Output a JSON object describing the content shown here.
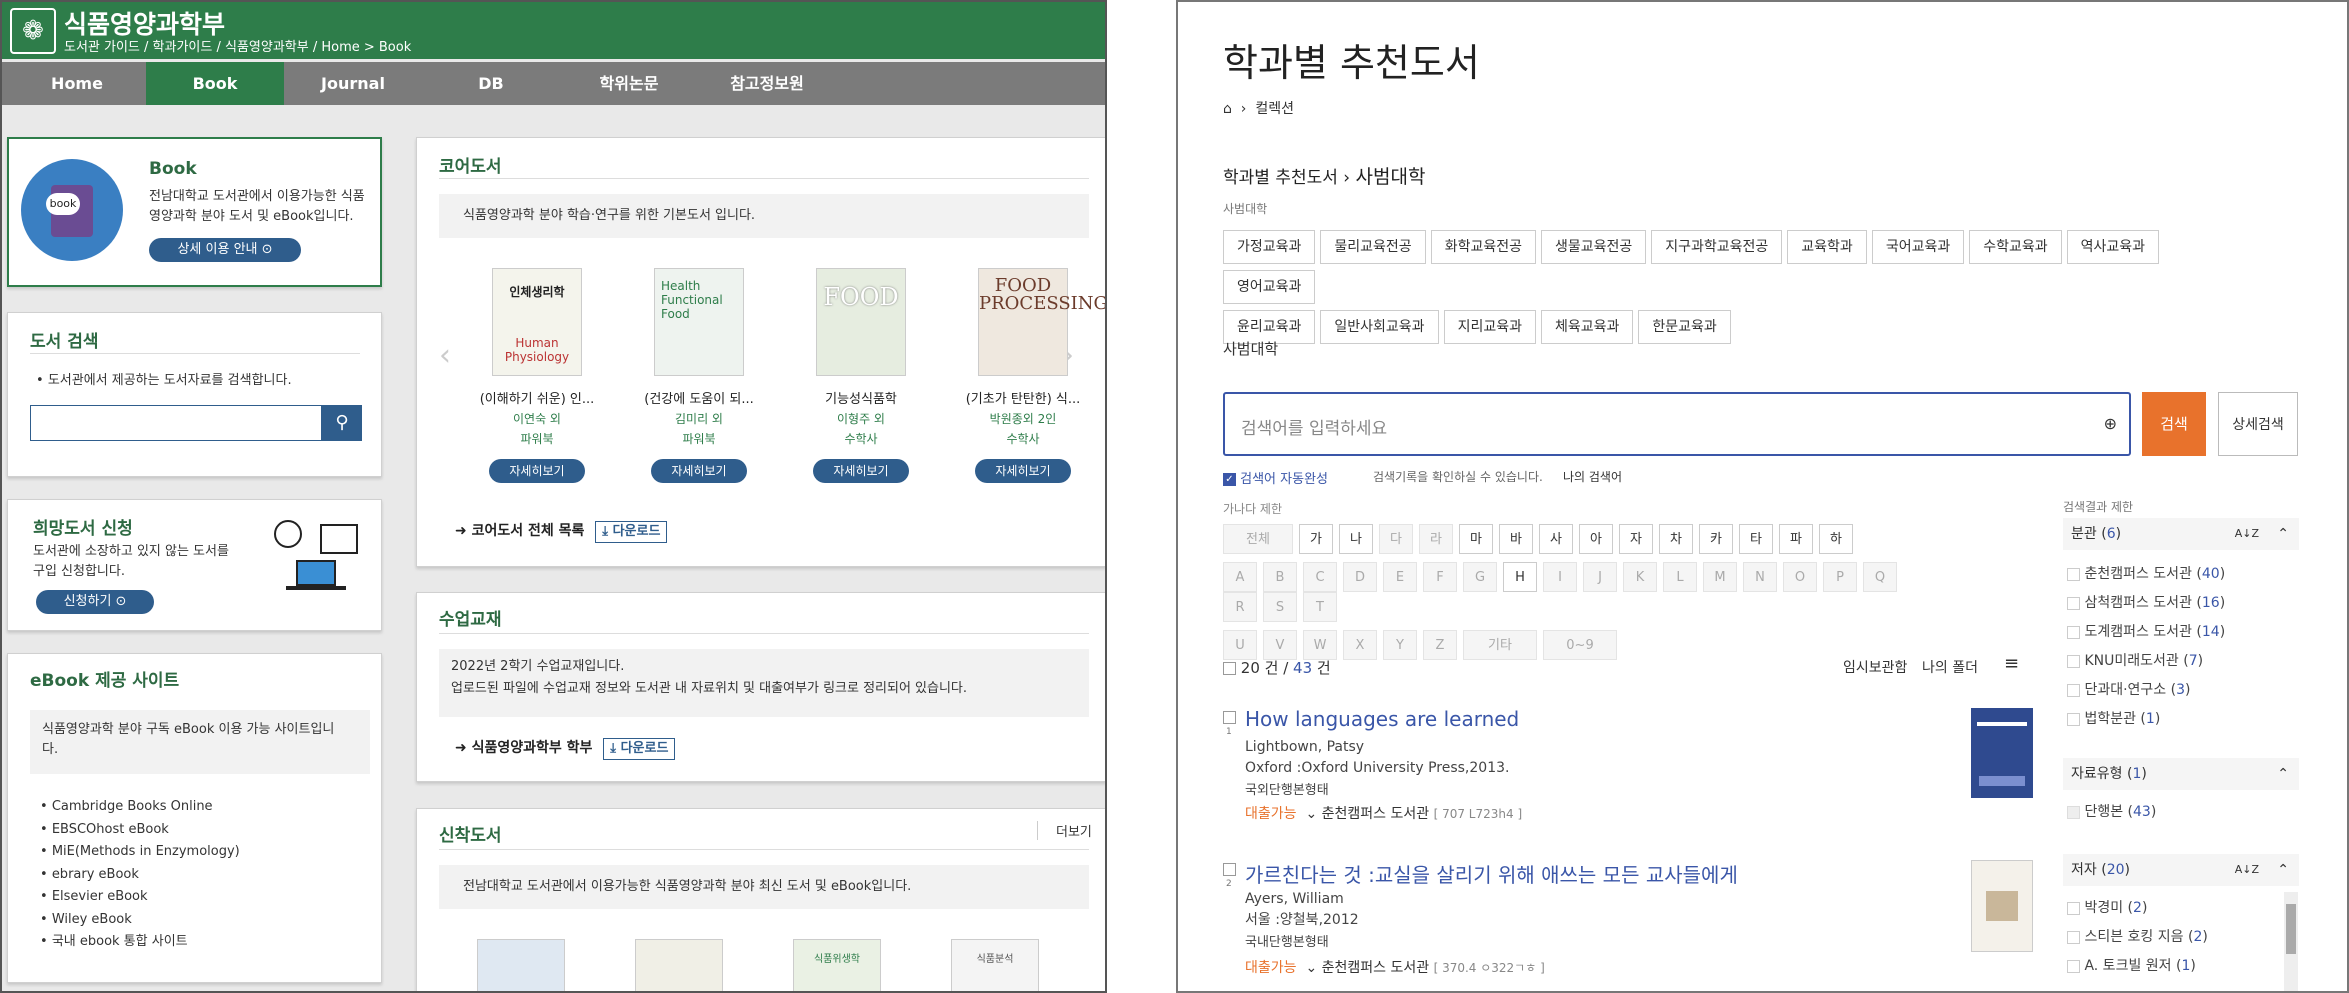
{
  "left": {
    "title": "식품영양과학부",
    "breadcrumb": "도서관 가이드 / 학과가이드 / 식품영양과학부 / Home > Book",
    "nav": [
      "Home",
      "Book",
      "Journal",
      "DB",
      "학위논문",
      "참고정보원"
    ],
    "book_box": {
      "icon_label": "book",
      "title": "Book",
      "desc1": "전남대학교 도서관에서 이용가능한 식품",
      "desc2": "영양과학 분야 도서 및 eBook입니다.",
      "button": "상세 이용 안내"
    },
    "search": {
      "title": "도서 검색",
      "desc": "도서관에서 제공하는 도서자료를 검색합니다."
    },
    "request": {
      "title": "희망도서 신청",
      "desc1": "도서관에 소장하고 있지 않는 도서를",
      "desc2": "구입 신청합니다.",
      "button": "신청하기"
    },
    "ebook": {
      "title": "eBook 제공 사이트",
      "desc": "식품영양과학 분야 구독 eBook 이용 가능 사이트입니",
      "desc2": "다.",
      "sites": [
        "Cambridge Books Online",
        "EBSCOhost eBook",
        "MiE(Methods in Enzymology)",
        "ebrary eBook",
        "Elsevier eBook",
        "Wiley eBook",
        "국내 ebook 통합 사이트"
      ]
    },
    "core": {
      "title": "코어도서",
      "desc": "식품영양과학 분야 학습·연구를 위한 기본도서 입니다.",
      "more": "코어도서 전체 목록",
      "download": "다운로드",
      "books": [
        {
          "title": "(이해하기 쉬운) 인...",
          "author": "이연숙 외",
          "publisher": "파워북",
          "button": "자세히보기",
          "cover_text": "인체생리학",
          "cover_sub": "Human Physiology"
        },
        {
          "title": "(건강에 도움이 되...",
          "author": "김미리 외",
          "publisher": "파워북",
          "button": "자세히보기",
          "cover_text": "Health Functional Food",
          "cover_sub": ""
        },
        {
          "title": "기능성식품학",
          "author": "이형주 외",
          "publisher": "수학사",
          "button": "자세히보기",
          "cover_text": "FOOD",
          "cover_sub": ""
        },
        {
          "title": "(기초가 탄탄한) 식...",
          "author": "박원종외 2인",
          "publisher": "수학사",
          "button": "자세히보기",
          "cover_text": "FOOD PROCESSING",
          "cover_sub": ""
        }
      ]
    },
    "textbook": {
      "title": "수업교재",
      "line1": "2022년 2학기 수업교재입니다.",
      "line2": "업로드된 파일에 수업교재 정보와 도서관 내 자료위치 및 대출여부가 링크로 정리되어 있습니다.",
      "item": "식품영양과학부 학부",
      "download": "다운로드"
    },
    "newbooks": {
      "title": "신착도서",
      "more": "더보기",
      "desc": "전남대학교 도서관에서 이용가능한 식품영양과학 분야 최신 도서 및 eBook입니다.",
      "cover_labels": [
        "",
        "",
        "식품위생학",
        "식품분석"
      ]
    }
  },
  "right": {
    "title": "학과별 추천도서",
    "crumb": "컬렉션",
    "section": "학과별 추천도서",
    "college": "사범대학",
    "college_small": "사범대학",
    "chips": [
      "가정교육과",
      "물리교육전공",
      "화학교육전공",
      "생물교육전공",
      "지구과학교육전공",
      "교육학과",
      "국어교육과",
      "수학교육과",
      "역사교육과",
      "영어교육과",
      "윤리교육과",
      "일반사회교육과",
      "지리교육과",
      "체육교육과",
      "한문교육과"
    ],
    "college_label": "사범대학",
    "search_placeholder": "검색어를 입력하세요",
    "search_btn": "검색",
    "adv_btn": "상세검색",
    "autocomplete": "검색어 자동완성",
    "history_note": "검색기록을 확인하실 수 있습니다.",
    "my_search": "나의 검색어",
    "alpha_label": "가나다 제한",
    "row1": [
      "전체",
      "가",
      "나",
      "다",
      "라",
      "마",
      "바",
      "사",
      "아",
      "자",
      "차",
      "카",
      "타",
      "파",
      "하"
    ],
    "row2": [
      "A",
      "B",
      "C",
      "D",
      "E",
      "F",
      "G",
      "H",
      "I",
      "J",
      "K",
      "L",
      "M",
      "N",
      "O",
      "P",
      "Q",
      "R",
      "S",
      "T"
    ],
    "row3": [
      "U",
      "V",
      "W",
      "X",
      "Y",
      "Z",
      "기타",
      "0~9"
    ],
    "count_shown": "20 건",
    "count_total": "43",
    "count_unit": "건",
    "temp_save": "임시보관함",
    "my_folder": "나의 폴더",
    "results": [
      {
        "num": "1",
        "title": "How languages are learned",
        "author": "Lightbown, Patsy",
        "pub": "Oxford :Oxford University Press,2013.",
        "type": "국외단행본형태",
        "avail": "대출가능",
        "loc": "춘천캠퍼스 도서관",
        "call": "[ 707 L723h4 ]"
      },
      {
        "num": "2",
        "title": "가르친다는 것 :교실을 살리기 위해 애쓰는 모든 교사들에게",
        "author": "Ayers, William",
        "pub": "서울 :양철북,2012",
        "type": "국내단행본형태",
        "avail": "대출가능",
        "loc": "춘천캠퍼스 도서관",
        "call": "[ 370.4 ㅇ322ㄱㅎ ]"
      }
    ],
    "facets_title": "검색결과 제한",
    "facet_branch": {
      "label": "분관",
      "count": "6",
      "items": [
        [
          "춘천캠퍼스 도서관",
          "40"
        ],
        [
          "삼척캠퍼스 도서관",
          "16"
        ],
        [
          "도계캠퍼스 도서관",
          "14"
        ],
        [
          "KNU미래도서관",
          "7"
        ],
        [
          "단과대·연구소",
          "3"
        ],
        [
          "법학분관",
          "1"
        ]
      ]
    },
    "facet_type": {
      "label": "자료유형",
      "count": "1",
      "items": [
        [
          "단행본",
          "43"
        ]
      ]
    },
    "facet_author": {
      "label": "저자",
      "count": "20",
      "items": [
        [
          "박경미",
          "2"
        ],
        [
          "스티븐 호킹 지음",
          "2"
        ],
        [
          "A. 토크빌 원저",
          "1"
        ]
      ]
    },
    "colors": {
      "green": "#2e7d4a",
      "blue": "#3a56a8",
      "orange": "#e8722c"
    }
  }
}
